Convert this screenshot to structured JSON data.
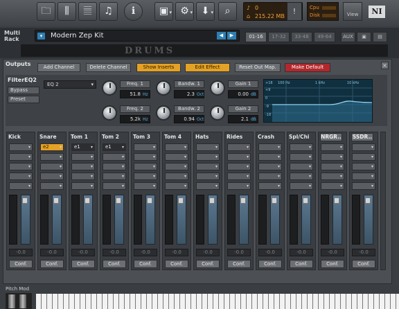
{
  "toolbar": {
    "icons": [
      "folder-icon",
      "mixer-icon",
      "keyboard-icon",
      "tuner-icon",
      "info-icon",
      "save-icon",
      "gear-icon",
      "download-icon",
      "search-icon"
    ],
    "voices": "0",
    "memory": "215.22 MB",
    "cpu_label": "Cpu",
    "disk_label": "Disk",
    "view_label": "View",
    "logo": "NI"
  },
  "rack": {
    "label_line1": "Multi",
    "label_line2": "Rack",
    "instrument_name": "Modern Zep Kit",
    "page_tabs": [
      "01-16",
      "17-32",
      "33-48",
      "49-64"
    ],
    "aux_label": "AUX",
    "backdrop_text": "DRUMS"
  },
  "outputs": {
    "title": "Outputs",
    "buttons": {
      "add_channel": "Add Channel",
      "delete_channel": "Delete Channel",
      "show_inserts": "Show Inserts",
      "edit_effect": "Edit Effect",
      "reset_out_map": "Reset Out Map.",
      "make_default": "Make Default"
    },
    "close": "×"
  },
  "effect": {
    "name": "FilterEQ2",
    "bypass": "Bypass",
    "preset": "Preset",
    "type": "EQ 2",
    "params": [
      {
        "label": "Freq. 1",
        "value": "51.8",
        "unit": "Hz"
      },
      {
        "label": "Bandw. 1",
        "value": "2.3",
        "unit": "Oct"
      },
      {
        "label": "Gain 1",
        "value": "0.00",
        "unit": "dB"
      },
      {
        "label": "Freq. 2",
        "value": "5.2k",
        "unit": "Hz"
      },
      {
        "label": "Bandw. 2",
        "value": "0.94",
        "unit": "Oct"
      },
      {
        "label": "Gain 2",
        "value": "2.1",
        "unit": "dB"
      }
    ],
    "graph": {
      "y_labels": [
        "+18",
        "+9",
        "0",
        "-9",
        "-18"
      ],
      "x_labels": [
        "100 Hz",
        "1 kHz",
        "10 kHz"
      ]
    }
  },
  "channels": [
    {
      "name": "Kick",
      "slot1": "",
      "boxed": false
    },
    {
      "name": "Snare",
      "slot1": "e2",
      "boxed": false,
      "highlight": true
    },
    {
      "name": "Tom 1",
      "slot1": "e1",
      "boxed": false,
      "dark": true
    },
    {
      "name": "Tom 2",
      "slot1": "e1",
      "boxed": false,
      "dark": true
    },
    {
      "name": "Tom 3",
      "slot1": "",
      "boxed": false
    },
    {
      "name": "Tom 4",
      "slot1": "",
      "boxed": false
    },
    {
      "name": "Hats",
      "slot1": "",
      "boxed": false
    },
    {
      "name": "Rides",
      "slot1": "",
      "boxed": false
    },
    {
      "name": "Crash",
      "slot1": "",
      "boxed": false
    },
    {
      "name": "Spl/Chi",
      "slot1": "",
      "boxed": false
    },
    {
      "name": "NRGR..",
      "slot1": "",
      "boxed": true
    },
    {
      "name": "SSDR..",
      "slot1": "",
      "boxed": true
    }
  ],
  "channel_common": {
    "volume": "-0.0",
    "config": "Conf."
  },
  "bottom": {
    "pitch_mod": "Pitch Mod"
  }
}
